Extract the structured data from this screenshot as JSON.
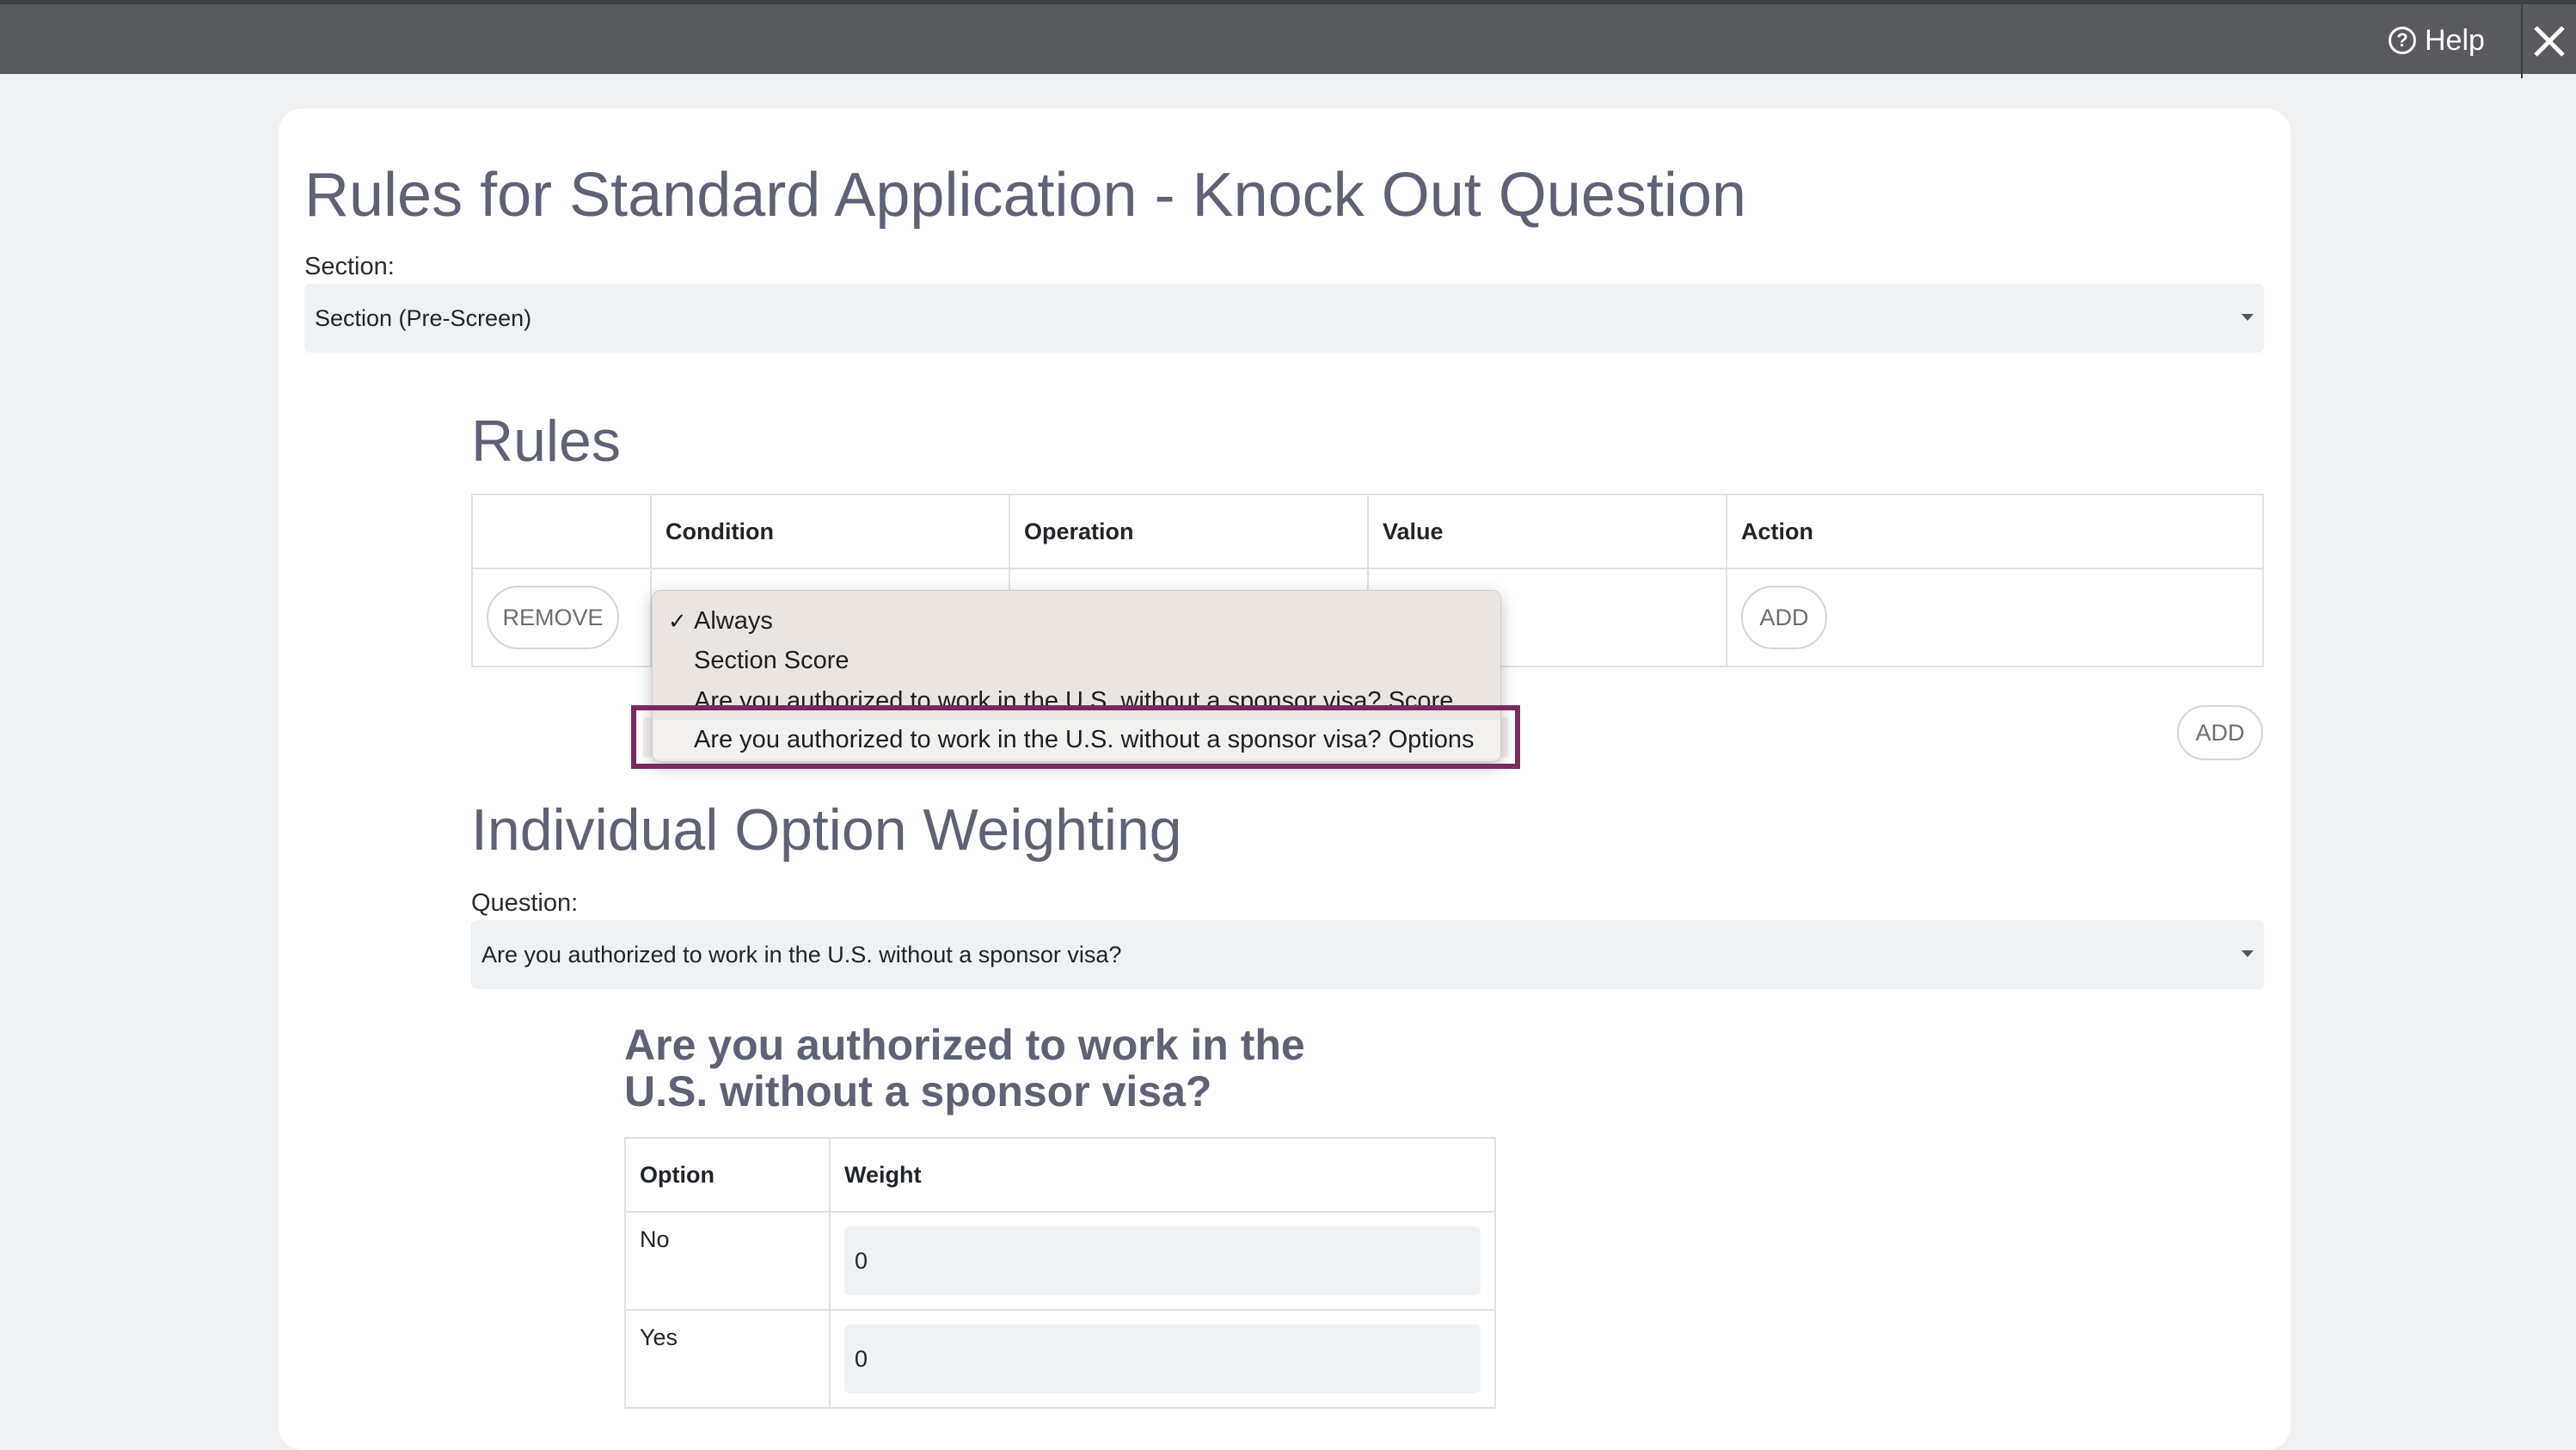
{
  "topbar": {
    "help_label": "Help",
    "help_icon": "question-circle-icon",
    "close_icon": "close-icon"
  },
  "page": {
    "title": "Rules for Standard Application - Knock Out Question",
    "section_label": "Section:",
    "section_value": "Section (Pre-Screen)"
  },
  "rules": {
    "heading": "Rules",
    "columns": [
      "",
      "Condition",
      "Operation",
      "Value",
      "Action"
    ],
    "row": {
      "remove_label": "REMOVE",
      "add_label": "ADD"
    },
    "add_rule_label": "ADD"
  },
  "condition_dropdown": {
    "options": [
      {
        "label": "Always",
        "selected": true
      },
      {
        "label": "Section Score",
        "selected": false
      },
      {
        "label": "Are you authorized to work in the U.S. without a sponsor visa? Score",
        "selected": false
      },
      {
        "label": "Are you authorized to work in the U.S. without a sponsor visa? Options",
        "selected": false,
        "highlighted": true
      }
    ],
    "check_mark": "✓",
    "highlight_color": "#7b2a5f"
  },
  "weighting": {
    "heading": "Individual Option Weighting",
    "question_label": "Question:",
    "question_value": "Are you authorized to work in the U.S. without a sponsor visa?",
    "question_title": "Are you authorized to work in the U.S. without a sponsor visa?",
    "columns": [
      "Option",
      "Weight"
    ],
    "rows": [
      {
        "option": "No",
        "weight": "0"
      },
      {
        "option": "Yes",
        "weight": "0"
      }
    ]
  }
}
